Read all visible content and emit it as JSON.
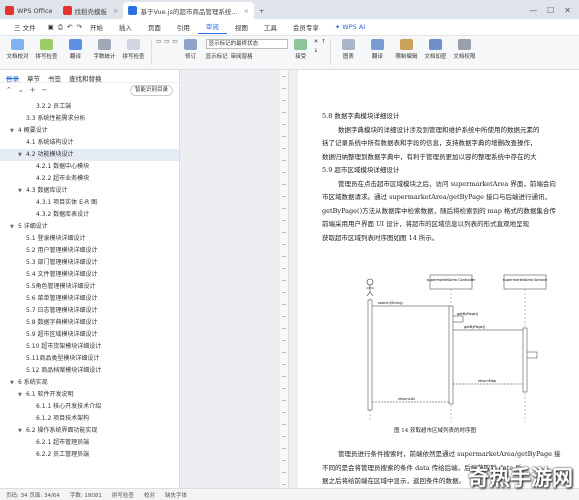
{
  "tabs": [
    {
      "label": "WPS Office",
      "color": "#e5322d"
    },
    {
      "label": "找稻壳模板",
      "color": "#e5322d"
    },
    {
      "label": "基于Vue.js的超市商品管理系统...",
      "color": "#2b6fe0"
    }
  ],
  "menu": {
    "file": "三 文件",
    "items": [
      "开始",
      "插入",
      "页面",
      "引用",
      "审阅",
      "视图",
      "工具",
      "会员专享"
    ],
    "active": "审阅",
    "ai": "WPS AI"
  },
  "ribbon": {
    "buttons": [
      "文档校对",
      "拼写检查",
      "翻译",
      "字数统计",
      "拼写检查"
    ],
    "track_select": "显示标记的最终状态",
    "show_markup": "显示标记",
    "revise": "修订",
    "review_pane": "审阅窗格",
    "accept": "接受",
    "right_buttons": [
      "图表",
      "翻译",
      "限制编辑",
      "文档加密",
      "文档权限"
    ]
  },
  "sidebar": {
    "tabs": [
      "目录",
      "章节",
      "书签",
      "查找和替换"
    ],
    "smart_toc": "智能识别目录",
    "items": [
      {
        "label": "3.2.2 员工端",
        "level": 3
      },
      {
        "label": "3.3 系统性能需求分析",
        "level": 2
      },
      {
        "label": "4 概要设计",
        "level": 1,
        "arrow": true
      },
      {
        "label": "4.1 系统结构设计",
        "level": 2
      },
      {
        "label": "4.2 功能模块设计",
        "level": 2,
        "arrow": true,
        "selected": true
      },
      {
        "label": "4.2.1 数据中心模块",
        "level": 3
      },
      {
        "label": "4.2.2 超市业务模块",
        "level": 3
      },
      {
        "label": "4.3 数据库设计",
        "level": 2,
        "arrow": true
      },
      {
        "label": "4.3.1 项目实体 E-R 图",
        "level": 3
      },
      {
        "label": "4.3.2 数据库表设计",
        "level": 3
      },
      {
        "label": "5 详细设计",
        "level": 1,
        "arrow": true
      },
      {
        "label": "5.1 登录模块详细设计",
        "level": 2
      },
      {
        "label": "5.2 用户管理模块详细设计",
        "level": 2
      },
      {
        "label": "5.3 部门管理模块详细设计",
        "level": 2
      },
      {
        "label": "5.4 文件管理模块详细设计",
        "level": 2
      },
      {
        "label": "5.5角色管理模块详细设计",
        "level": 2
      },
      {
        "label": "5.6 菜单管理模块详细设计",
        "level": 2
      },
      {
        "label": "5.7 日志管理模块详细设计",
        "level": 2
      },
      {
        "label": "5.8 数据字典模块详细设计",
        "level": 2
      },
      {
        "label": "5.9 超市区域模块详细设计",
        "level": 2
      },
      {
        "label": "5.10 超市货架模块详细设计",
        "level": 2
      },
      {
        "label": "5.11商品类型模块详细设计",
        "level": 2
      },
      {
        "label": "5.12 商品档案模块详细设计",
        "level": 2
      },
      {
        "label": "6 系统实现",
        "level": 1,
        "arrow": true
      },
      {
        "label": "6.1 软件开发说明",
        "level": 2,
        "arrow": true
      },
      {
        "label": "6.1.1 核心开发技术介绍",
        "level": 3
      },
      {
        "label": "6.1.2 项目技术架构",
        "level": 3
      },
      {
        "label": "6.2 操作系统界面功能实现",
        "level": 2,
        "arrow": true
      },
      {
        "label": "6.2.1 超市管理员端",
        "level": 3
      },
      {
        "label": "6.2.2 员工管理员端",
        "level": 3
      }
    ]
  },
  "doc": {
    "lines": [
      {
        "cls": "h",
        "text": "5.8  数据字典模块详细设计"
      },
      {
        "cls": "ind",
        "text": "数据字典模块的详细设计涉及到管理和维护系统中所使用的数据元素的"
      },
      {
        "cls": "",
        "text": "括了记录系统中所有数据表和字段的信息，支持数据字典的增删改查操作，"
      },
      {
        "cls": "",
        "text": "数据归纳整理到数据字典中，有利于管理员更加以容的整理系统中存在的大"
      },
      {
        "cls": "h",
        "text": "5.9  超市区域模块详细设计"
      },
      {
        "cls": "ind",
        "text": "管理员在点击超市区域模块之后，访问 supermarketArea 界面，前端会向"
      },
      {
        "cls": "",
        "text": "市区域数据请求。通过 supermarketArea/getByPage 接口与后端进行通讯，"
      },
      {
        "cls": "",
        "text": "getByPage()方法从数据库中检索数据，随后将检索到的 map 格式的数据集合传"
      },
      {
        "cls": "",
        "text": "前端采用用户界面 UI 设计，将超市的区域信息以列表的形式直观地呈现"
      },
      {
        "cls": "",
        "text": "获取超市区域列表时序图如图 14 所示。"
      }
    ],
    "caption": "图 14  获取超市区域列表的时序图",
    "after": [
      {
        "cls": "ind",
        "text": "管理员进行条件搜索时，前端依然是通过 supermarketArea/getByPage 接"
      },
      {
        "cls": "",
        "text": "不同的是会将管理员搜索的条件 data 传给后端，后端获取到 data 后"
      },
      {
        "cls": "",
        "text": "据之后将给前端在区域中显示，返回条件的数据。"
      }
    ],
    "diagram": {
      "lifelines": [
        "supermarketArea Controller",
        "supermarketArea Service"
      ],
      "messages": [
        "search(String)",
        "getByPage()",
        "getByPage()",
        "returnMap",
        "returnList"
      ]
    }
  },
  "status": {
    "page": "页码: 34  页面: 34/64",
    "words": "字数: 18081",
    "spell": "拼写检查",
    "proof": "校对",
    "missing": "缺失字体"
  },
  "watermark": "奇热手游网"
}
